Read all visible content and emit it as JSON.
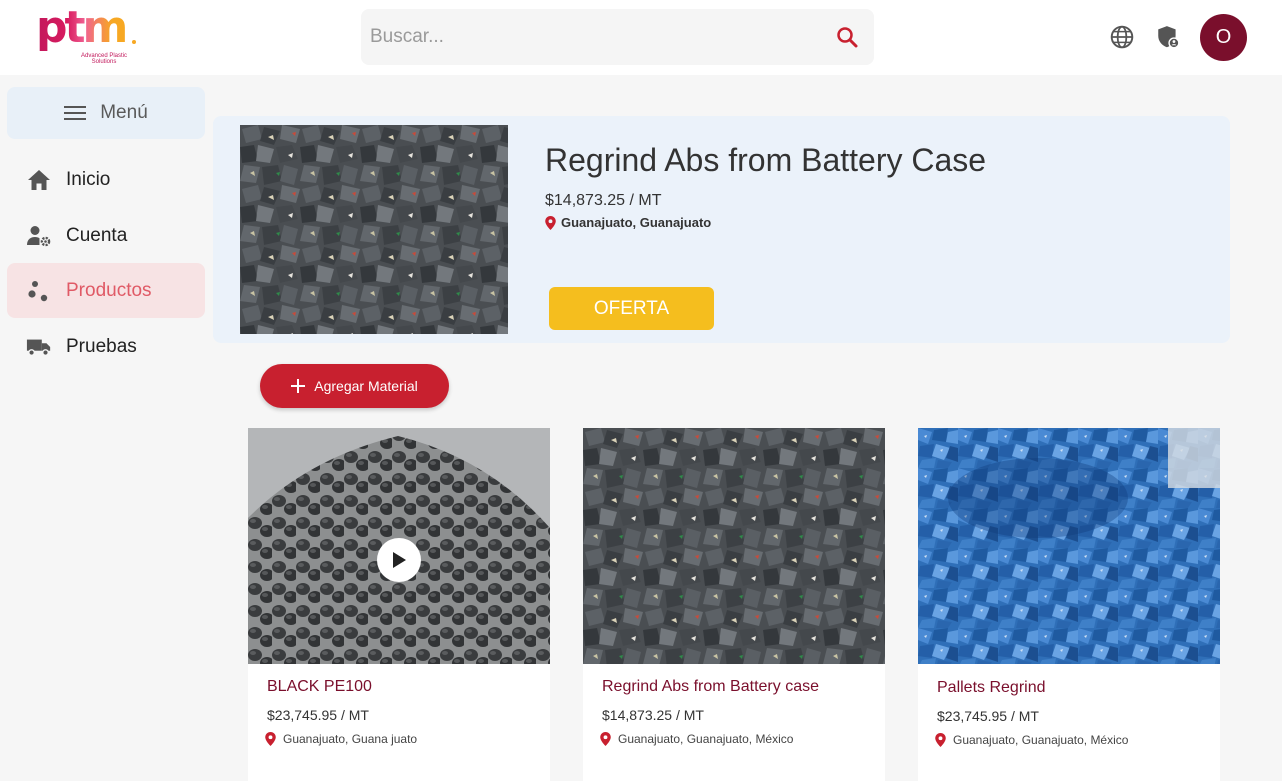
{
  "brand": {
    "logo_text": "ptm",
    "logo_tagline": "Advanced Plastic Solutions",
    "accent": "#7a0f2c"
  },
  "header": {
    "search_placeholder": "Buscar...",
    "avatar_initial": "O",
    "icons": [
      "globe-icon",
      "shield-user-icon"
    ]
  },
  "sidebar": {
    "menu_label": "Menú",
    "items": [
      {
        "label": "Inicio",
        "icon": "home-icon",
        "active": false
      },
      {
        "label": "Cuenta",
        "icon": "user-gear-icon",
        "active": false
      },
      {
        "label": "Productos",
        "icon": "scatter-dots-icon",
        "active": true
      },
      {
        "label": "Pruebas",
        "icon": "truck-icon",
        "active": false
      }
    ]
  },
  "featured": {
    "title": "Regrind Abs from Battery Case",
    "price": "$14,873.25 / MT",
    "location": "Guanajuato, Guanajuato",
    "cta": "OFERTA",
    "cta_color": "#f5be1e"
  },
  "actions": {
    "add_material": "Agregar Material",
    "add_color": "#c8202f"
  },
  "products": [
    {
      "name": "BLACK PE100",
      "price": "$23,745.95 / MT",
      "location": "Guanajuato, Guana juato",
      "has_video": true
    },
    {
      "name": "Regrind Abs from Battery case",
      "price": "$14,873.25 / MT",
      "location": "Guanajuato, Guanajuato, México",
      "has_video": false
    },
    {
      "name": "Pallets Regrind",
      "price": "$23,745.95 / MT",
      "location": "Guanajuato, Guanajuato, México",
      "has_video": false
    }
  ]
}
